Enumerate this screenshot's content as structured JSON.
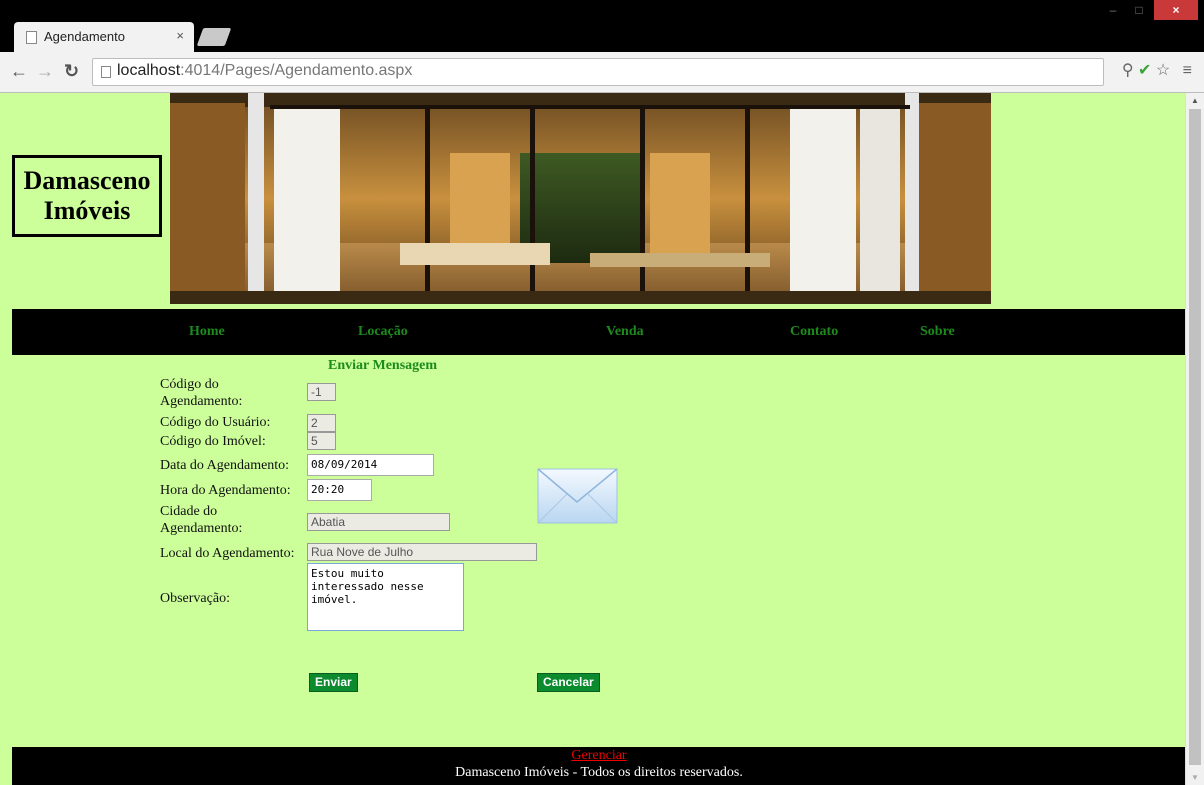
{
  "browser": {
    "tab_title": "Agendamento",
    "tab_close": "×",
    "url_host": "localhost",
    "url_path": ":4014/Pages/Agendamento.aspx",
    "window_controls": {
      "minimize": "–",
      "maximize": "□",
      "close": "×"
    },
    "icons": [
      "page-icon",
      "back-icon",
      "forward-icon",
      "reload-icon",
      "search-icon",
      "check-icon",
      "star-icon",
      "menu-icon"
    ]
  },
  "site": {
    "logo_line1": "Damasceno",
    "logo_line2": "Imóveis",
    "nav": {
      "home": "Home",
      "locacao": "Locação",
      "venda": "Venda",
      "contato": "Contato",
      "sobre": "Sobre"
    }
  },
  "form": {
    "title": "Enviar Mensagem",
    "labels": {
      "cod_agendamento": "Código do Agendamento:",
      "cod_usuario": "Código do Usuário:",
      "cod_imovel": "Código do Imóvel:",
      "data": "Data do Agendamento:",
      "hora": "Hora do Agendamento:",
      "cidade": "Cidade do Agendamento:",
      "local": "Local do Agendamento:",
      "observacao": "Observação:"
    },
    "values": {
      "cod_agendamento": "-1",
      "cod_usuario": "2",
      "cod_imovel": "5",
      "data": "08/09/2014",
      "hora": "20:20",
      "cidade": "Abatia",
      "local": "Rua Nove de Julho",
      "observacao": "Estou muito interessado nesse imóvel."
    },
    "buttons": {
      "enviar": "Enviar",
      "cancelar": "Cancelar"
    }
  },
  "footer": {
    "manage_link": "Gerenciar",
    "copyright": "Damasceno Imóveis - Todos os direitos reservados."
  },
  "colors": {
    "page_bg": "#ccff99",
    "nav_text": "#1d8a1d",
    "button_bg": "#0b8a2e",
    "link_red": "#ee0000"
  }
}
